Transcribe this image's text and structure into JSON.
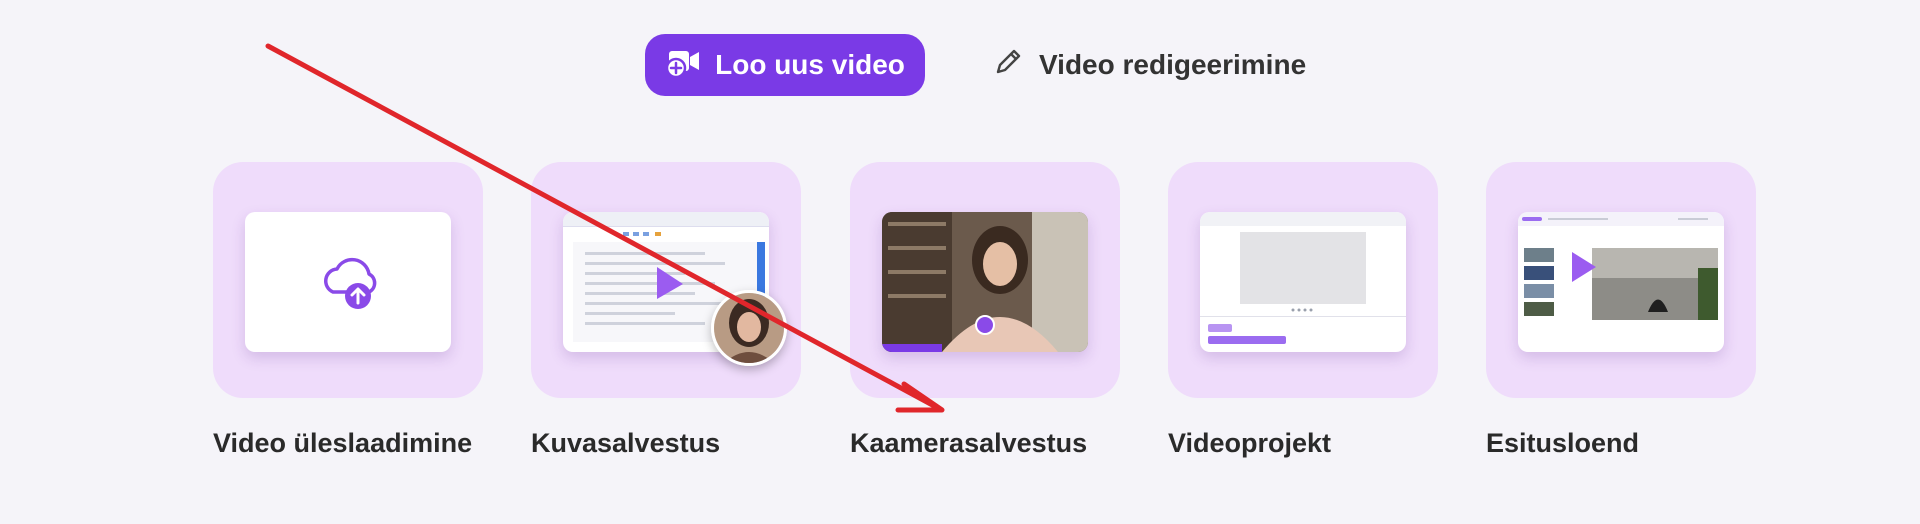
{
  "tabs": {
    "create_video": "Loo uus video",
    "edit_video": "Video redigeerimine"
  },
  "cards": [
    {
      "label": "Video üleslaadimine",
      "icon": "cloud-upload-icon"
    },
    {
      "label": "Kuvasalvestus",
      "icon": "screen-recording-preview"
    },
    {
      "label": "Kaamerasalvestus",
      "icon": "camera-recording-preview"
    },
    {
      "label": "Videoprojekt",
      "icon": "video-project-preview"
    },
    {
      "label": "Esitusloend",
      "icon": "playlist-preview"
    }
  ],
  "colors": {
    "accent": "#7a3ae6",
    "card_bg": "#efdcfb",
    "annotation_arrow": "#e0262b"
  }
}
